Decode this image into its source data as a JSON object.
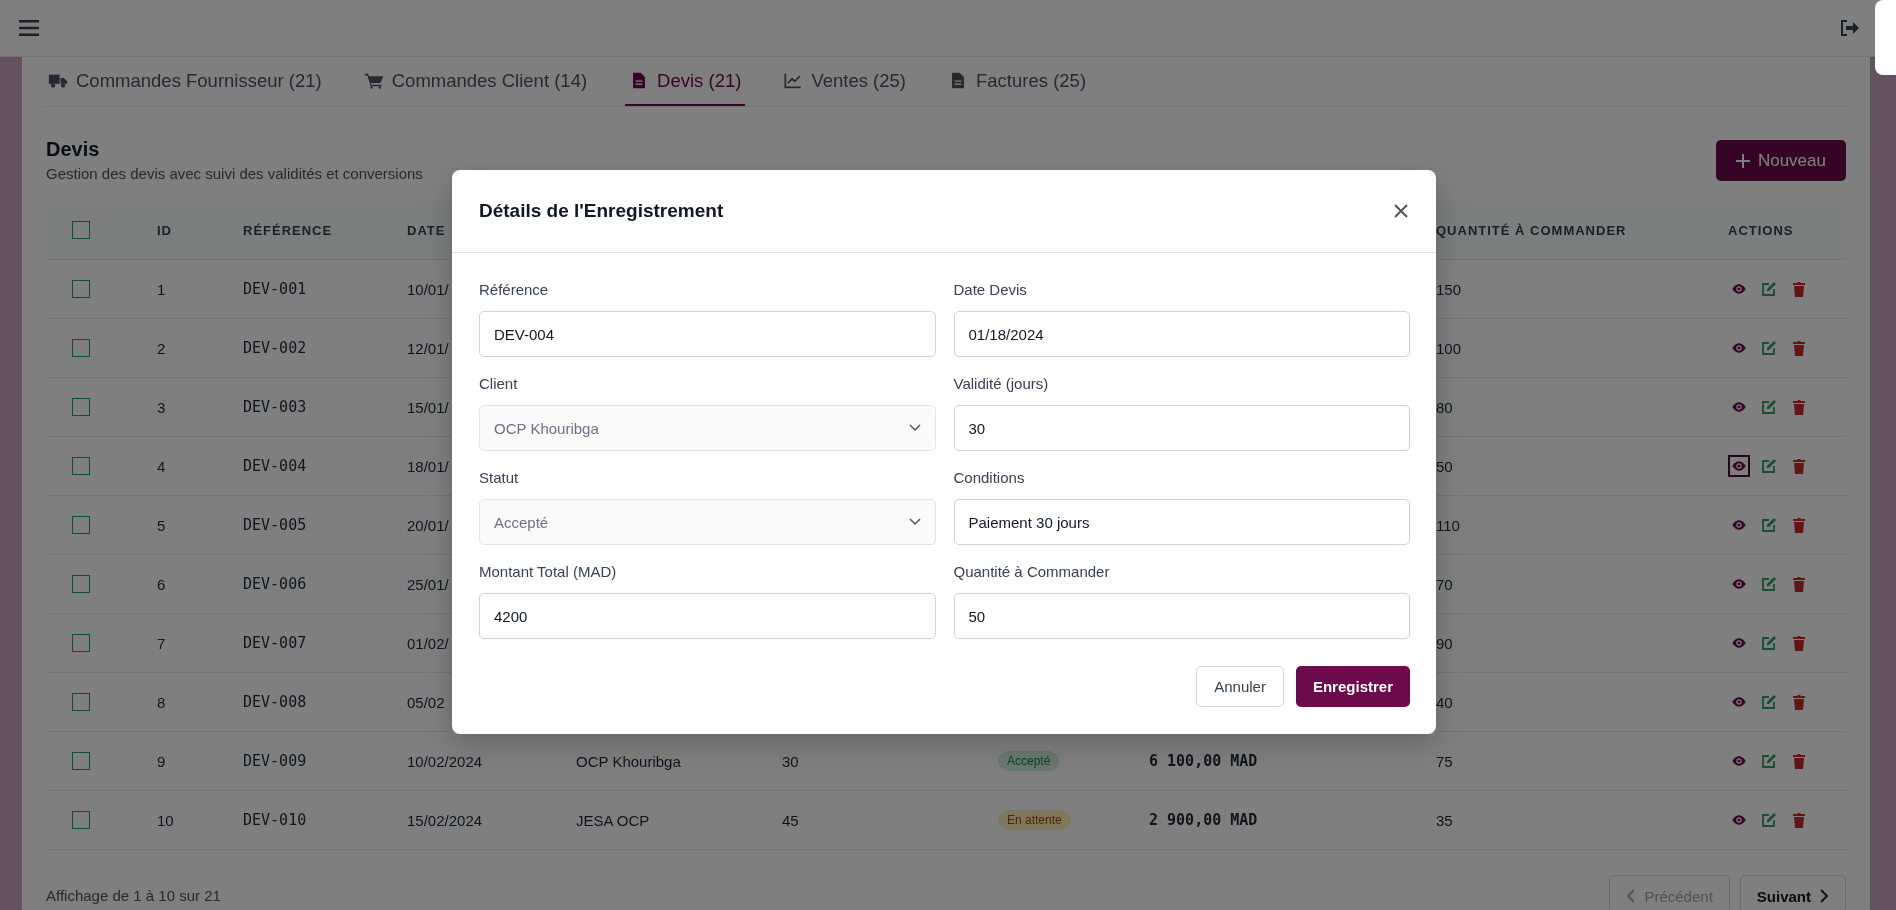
{
  "tabs": [
    {
      "label": "Commandes Fournisseur (21)",
      "selected": false
    },
    {
      "label": "Commandes Client (14)",
      "selected": false
    },
    {
      "label": "Devis (21)",
      "selected": true
    },
    {
      "label": "Ventes (25)",
      "selected": false
    },
    {
      "label": "Factures (25)",
      "selected": false
    }
  ],
  "section": {
    "title": "Devis",
    "subtitle": "Gestion des devis avec suivi des validités et conversions",
    "new_button": "Nouveau"
  },
  "table": {
    "select_all_checked": false,
    "columns": [
      "ID",
      "RÉFÉRENCE",
      "DATE",
      "QUANTITÉ À COMMANDER",
      "ACTIONS"
    ],
    "rows": [
      {
        "checked": false,
        "id": "1",
        "reference": "DEV-001",
        "date": "10/01/",
        "quantity": "150",
        "view_focused": false
      },
      {
        "checked": false,
        "id": "2",
        "reference": "DEV-002",
        "date": "12/01/",
        "quantity": "100",
        "view_focused": false
      },
      {
        "checked": false,
        "id": "3",
        "reference": "DEV-003",
        "date": "15/01/",
        "quantity": "80",
        "view_focused": false
      },
      {
        "checked": false,
        "id": "4",
        "reference": "DEV-004",
        "date": "18/01/",
        "quantity": "50",
        "view_focused": true
      },
      {
        "checked": false,
        "id": "5",
        "reference": "DEV-005",
        "date": "20/01/",
        "quantity": "110",
        "view_focused": false
      },
      {
        "checked": false,
        "id": "6",
        "reference": "DEV-006",
        "date": "25/01/",
        "quantity": "70",
        "view_focused": false
      },
      {
        "checked": false,
        "id": "7",
        "reference": "DEV-007",
        "date": "01/02/",
        "quantity": "90",
        "view_focused": false
      },
      {
        "checked": false,
        "id": "8",
        "reference": "DEV-008",
        "date": "05/02",
        "quantity": "40",
        "view_focused": false
      },
      {
        "checked": false,
        "id": "9",
        "reference": "DEV-009",
        "date": "10/02/2024",
        "client": "OCP Khouribga",
        "validity": "30",
        "status": {
          "label": "Accepté",
          "kind": "accepted"
        },
        "amount": "6 100,00 MAD",
        "quantity": "75",
        "view_focused": false
      },
      {
        "checked": false,
        "id": "10",
        "reference": "DEV-010",
        "date": "15/02/2024",
        "client": "JESA OCP",
        "validity": "45",
        "status": {
          "label": "En attente",
          "kind": "pending"
        },
        "amount": "2 900,00 MAD",
        "quantity": "35",
        "view_focused": false
      }
    ]
  },
  "footer": {
    "summary": "Affichage de 1 à 10 sur 21",
    "previous": {
      "label": "Précédent",
      "disabled": true
    },
    "next": {
      "label": "Suivant",
      "disabled": false
    }
  },
  "modal": {
    "title": "Détails de l'Enregistrement",
    "fields": [
      {
        "label": "Référence",
        "kind": "text",
        "value": "DEV-004"
      },
      {
        "label": "Date Devis",
        "kind": "text",
        "value": "01/18/2024"
      },
      {
        "label": "Client",
        "kind": "select",
        "value": "OCP Khouribga"
      },
      {
        "label": "Validité (jours)",
        "kind": "text",
        "value": "30"
      },
      {
        "label": "Statut",
        "kind": "select",
        "value": "Accepté"
      },
      {
        "label": "Conditions",
        "kind": "text",
        "value": "Paiement 30 jours"
      },
      {
        "label": "Montant Total (MAD)",
        "kind": "text",
        "value": "4200"
      },
      {
        "label": "Quantité à Commander",
        "kind": "text",
        "value": "50"
      }
    ],
    "cancel_button": "Annuler",
    "save_button": "Enregistrer"
  }
}
